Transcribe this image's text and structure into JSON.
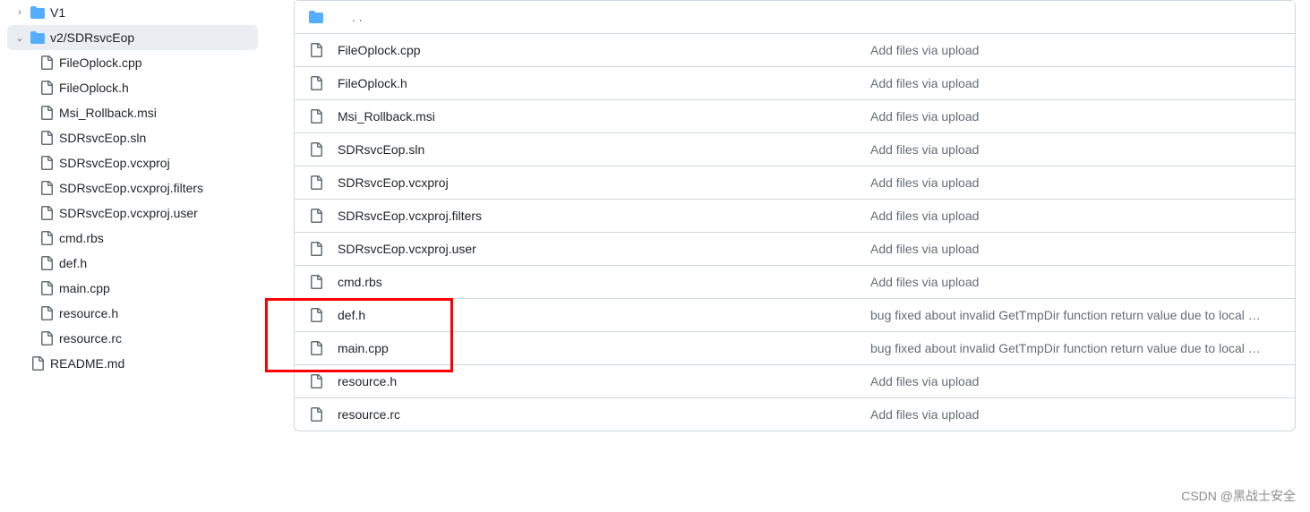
{
  "sidebar": {
    "items": [
      {
        "type": "folder",
        "label": "V1",
        "chevron": "right",
        "level": 0,
        "active": false
      },
      {
        "type": "folder",
        "label": "v2/SDRsvcEop",
        "chevron": "down",
        "level": 0,
        "active": true
      },
      {
        "type": "file",
        "label": "FileOplock.cpp",
        "level": 1,
        "active": false
      },
      {
        "type": "file",
        "label": "FileOplock.h",
        "level": 1,
        "active": false
      },
      {
        "type": "file",
        "label": "Msi_Rollback.msi",
        "level": 1,
        "active": false
      },
      {
        "type": "file",
        "label": "SDRsvcEop.sln",
        "level": 1,
        "active": false
      },
      {
        "type": "file",
        "label": "SDRsvcEop.vcxproj",
        "level": 1,
        "active": false
      },
      {
        "type": "file",
        "label": "SDRsvcEop.vcxproj.filters",
        "level": 1,
        "active": false
      },
      {
        "type": "file",
        "label": "SDRsvcEop.vcxproj.user",
        "level": 1,
        "active": false
      },
      {
        "type": "file",
        "label": "cmd.rbs",
        "level": 1,
        "active": false
      },
      {
        "type": "file",
        "label": "def.h",
        "level": 1,
        "active": false
      },
      {
        "type": "file",
        "label": "main.cpp",
        "level": 1,
        "active": false
      },
      {
        "type": "file",
        "label": "resource.h",
        "level": 1,
        "active": false
      },
      {
        "type": "file",
        "label": "resource.rc",
        "level": 1,
        "active": false
      },
      {
        "type": "file",
        "label": "README.md",
        "level": 0,
        "active": false,
        "noChevron": true
      }
    ]
  },
  "main": {
    "parent_label": ". .",
    "rows": [
      {
        "name": "FileOplock.cpp",
        "commit": "Add files via upload"
      },
      {
        "name": "FileOplock.h",
        "commit": "Add files via upload"
      },
      {
        "name": "Msi_Rollback.msi",
        "commit": "Add files via upload"
      },
      {
        "name": "SDRsvcEop.sln",
        "commit": "Add files via upload"
      },
      {
        "name": "SDRsvcEop.vcxproj",
        "commit": "Add files via upload"
      },
      {
        "name": "SDRsvcEop.vcxproj.filters",
        "commit": "Add files via upload"
      },
      {
        "name": "SDRsvcEop.vcxproj.user",
        "commit": "Add files via upload"
      },
      {
        "name": "cmd.rbs",
        "commit": "Add files via upload"
      },
      {
        "name": "def.h",
        "commit": "bug fixed about invalid GetTmpDir function return value due to local …"
      },
      {
        "name": "main.cpp",
        "commit": "bug fixed about invalid GetTmpDir function return value due to local …"
      },
      {
        "name": "resource.h",
        "commit": "Add files via upload"
      },
      {
        "name": "resource.rc",
        "commit": "Add files via upload"
      }
    ]
  },
  "watermark": "CSDN @黑战士安全"
}
